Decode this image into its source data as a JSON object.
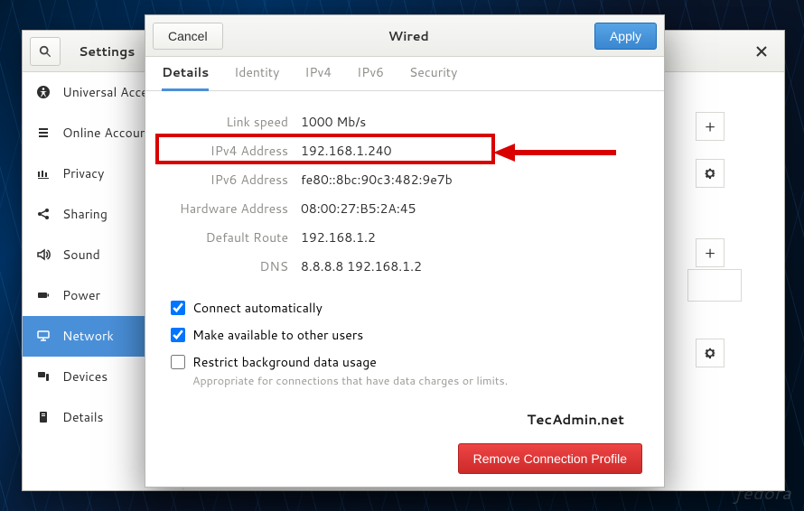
{
  "wallpaper_watermark": "fedora",
  "settings": {
    "title": "Settings",
    "sidebar": {
      "items": [
        {
          "label": "Universal Access"
        },
        {
          "label": "Online Accounts"
        },
        {
          "label": "Privacy"
        },
        {
          "label": "Sharing"
        },
        {
          "label": "Sound"
        },
        {
          "label": "Power"
        },
        {
          "label": "Network"
        },
        {
          "label": "Devices"
        },
        {
          "label": "Details"
        }
      ],
      "selected_index": 6
    }
  },
  "dialog": {
    "cancel": "Cancel",
    "title": "Wired",
    "apply": "Apply",
    "tabs": [
      "Details",
      "Identity",
      "IPv4",
      "IPv6",
      "Security"
    ],
    "active_tab": 0,
    "details": {
      "rows": [
        {
          "label": "Link speed",
          "value": "1000 Mb/s"
        },
        {
          "label": "IPv4 Address",
          "value": "192.168.1.240"
        },
        {
          "label": "IPv6 Address",
          "value": "fe80::8bc:90c3:482:9e7b"
        },
        {
          "label": "Hardware Address",
          "value": "08:00:27:B5:2A:45"
        },
        {
          "label": "Default Route",
          "value": "192.168.1.2"
        },
        {
          "label": "DNS",
          "value": "8.8.8.8 192.168.1.2"
        }
      ],
      "check_auto": {
        "label": "Connect automatically",
        "checked": true
      },
      "check_others": {
        "label": "Make available to other users",
        "checked": true
      },
      "check_restrict": {
        "label": "Restrict background data usage",
        "sub": "Appropriate for connections that have data charges or limits.",
        "checked": false
      }
    },
    "remove": "Remove Connection Profile",
    "watermark": "TecAdmin.net"
  }
}
